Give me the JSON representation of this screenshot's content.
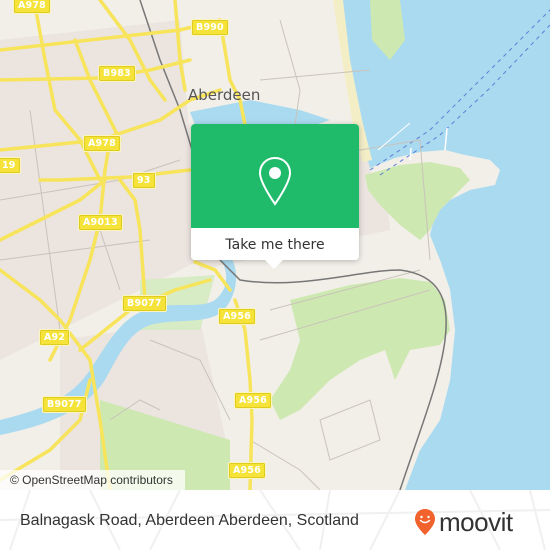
{
  "map": {
    "place_labels": [
      {
        "id": "aberdeen",
        "text": "Aberdeen"
      }
    ],
    "road_labels": [
      {
        "id": "a978-top",
        "text": "A978"
      },
      {
        "id": "b990",
        "text": "B990"
      },
      {
        "id": "b983",
        "text": "B983"
      },
      {
        "id": "a978-mid",
        "text": "A978"
      },
      {
        "id": "a19-edge",
        "text": "19"
      },
      {
        "id": "a93-partial",
        "text": "93"
      },
      {
        "id": "a9013",
        "text": "A9013"
      },
      {
        "id": "b9077-top",
        "text": "B9077"
      },
      {
        "id": "a92",
        "text": "A92"
      },
      {
        "id": "a956-top",
        "text": "A956"
      },
      {
        "id": "b9077-bottom",
        "text": "B9077"
      },
      {
        "id": "a956-mid",
        "text": "A956"
      },
      {
        "id": "a956-bottom",
        "text": "A956"
      }
    ],
    "attribution": "© OpenStreetMap contributors",
    "colors": {
      "land": "#f2efe9",
      "water": "#aadaef",
      "park": "#cde8b0",
      "road_major": "#f7e45a",
      "road_minor": "#c9c3bb",
      "residential": "#e8e0dc",
      "beach": "#f4eec7"
    }
  },
  "popup": {
    "icon": "map-pin-icon",
    "button_label": "Take me there",
    "accent_color": "#1fbb6b"
  },
  "footer": {
    "address": "Balnagask Road, Aberdeen Aberdeen, Scotland",
    "logo_text": "moovit",
    "logo_icon": "moovit-pin-smile-icon",
    "logo_color": "#f2622d"
  }
}
